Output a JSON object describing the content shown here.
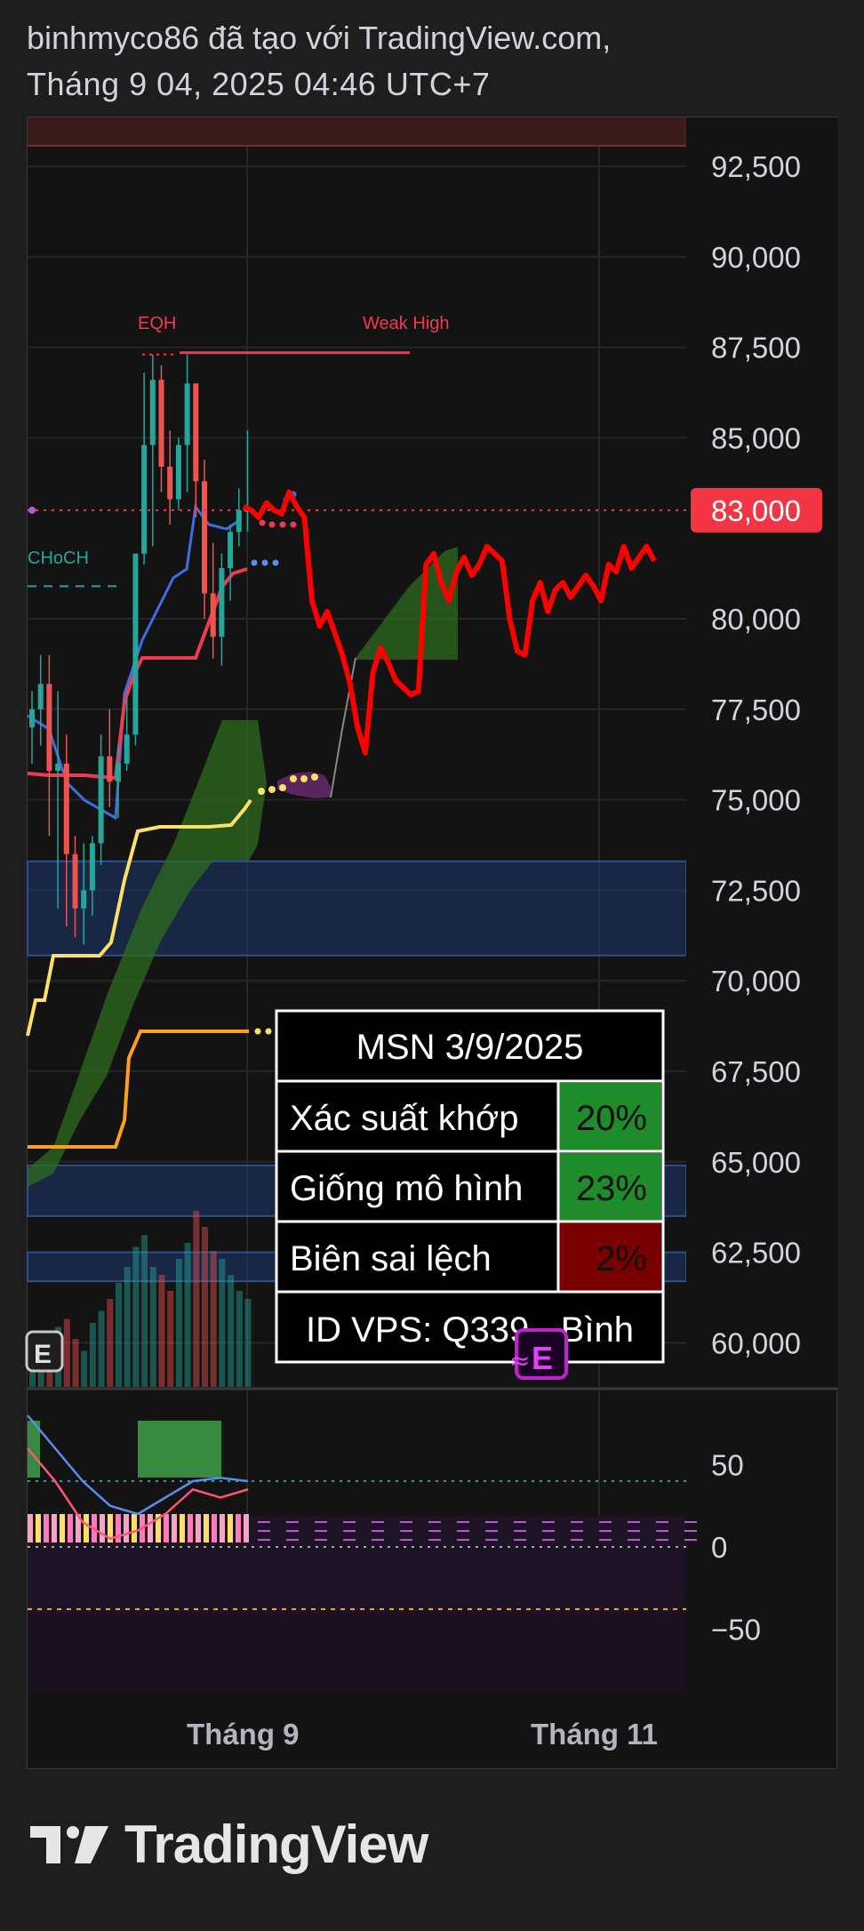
{
  "header": {
    "line1": "binhmyco86 đã tạo với TradingView.com,",
    "line2": "Tháng 9 04, 2025 04:46 UTC+7"
  },
  "brand": {
    "name": "TradingView",
    "icon": "tradingview-logo-icon"
  },
  "colors": {
    "background": "#131313",
    "page": "#1e1e1e",
    "up": "#26a69a",
    "down": "#ef5350",
    "price_label": "#f23645",
    "cloud_green": "#2e7d32",
    "cloud_purple": "#6a2c70",
    "forecast": "#ff0000",
    "yellow_line": "#ffe066",
    "orange_line": "#ff9f1c",
    "zone_blue": "#1e3a6e"
  },
  "chart_data": [
    {
      "type": "candlestick",
      "symbol": "MSN",
      "ylim": [
        59000,
        93500
      ],
      "y_ticks": [
        {
          "value": 92500,
          "label": "92,500"
        },
        {
          "value": 90000,
          "label": "90,000"
        },
        {
          "value": 87500,
          "label": "87,500"
        },
        {
          "value": 85000,
          "label": "85,000"
        },
        {
          "value": 80000,
          "label": "80,000"
        },
        {
          "value": 77500,
          "label": "77,500"
        },
        {
          "value": 75000,
          "label": "75,000"
        },
        {
          "value": 72500,
          "label": "72,500"
        },
        {
          "value": 70000,
          "label": "70,000"
        },
        {
          "value": 67500,
          "label": "67,500"
        },
        {
          "value": 65000,
          "label": "65,000"
        },
        {
          "value": 62500,
          "label": "62,500"
        },
        {
          "value": 60000,
          "label": "60,000"
        }
      ],
      "last_price": {
        "value": 83000,
        "label": "83,000"
      },
      "x_labels": [
        "Tháng 9",
        "Tháng 11"
      ],
      "annotations": {
        "eqh": "EQH",
        "weak_high": "Weak High",
        "choch": "CHoCH",
        "earnings_marker": "E"
      },
      "levels": {
        "eqh_line": 87300,
        "choch_line": 80900
      },
      "zones": [
        {
          "from": 70700,
          "to": 73300
        },
        {
          "from": 63500,
          "to": 64900
        },
        {
          "from": 61700,
          "to": 62500
        }
      ],
      "candles": [
        {
          "o": 77000,
          "h": 78000,
          "l": 76000,
          "c": 77500
        },
        {
          "o": 77500,
          "h": 79000,
          "l": 76500,
          "c": 78200
        },
        {
          "o": 78200,
          "h": 79000,
          "l": 74000,
          "c": 75800
        },
        {
          "o": 75800,
          "h": 78000,
          "l": 72000,
          "c": 76000
        },
        {
          "o": 76000,
          "h": 76800,
          "l": 71500,
          "c": 73500
        },
        {
          "o": 73500,
          "h": 74000,
          "l": 71200,
          "c": 72000
        },
        {
          "o": 72000,
          "h": 73800,
          "l": 71000,
          "c": 72500
        },
        {
          "o": 72500,
          "h": 74000,
          "l": 71800,
          "c": 73800
        },
        {
          "o": 73800,
          "h": 76800,
          "l": 73200,
          "c": 76200
        },
        {
          "o": 76200,
          "h": 77500,
          "l": 74800,
          "c": 75500
        },
        {
          "o": 75500,
          "h": 76500,
          "l": 74500,
          "c": 76000
        },
        {
          "o": 76000,
          "h": 77800,
          "l": 75800,
          "c": 76800
        },
        {
          "o": 76800,
          "h": 81800,
          "l": 76500,
          "c": 81800
        },
        {
          "o": 81800,
          "h": 86800,
          "l": 81500,
          "c": 84800
        },
        {
          "o": 84800,
          "h": 87300,
          "l": 82000,
          "c": 86600
        },
        {
          "o": 86600,
          "h": 87000,
          "l": 83500,
          "c": 84200
        },
        {
          "o": 84200,
          "h": 85200,
          "l": 82600,
          "c": 83300
        },
        {
          "o": 83300,
          "h": 85000,
          "l": 83000,
          "c": 84800
        },
        {
          "o": 84800,
          "h": 87300,
          "l": 83500,
          "c": 86500
        },
        {
          "o": 86500,
          "h": 86500,
          "l": 82800,
          "c": 83800
        },
        {
          "o": 83800,
          "h": 84400,
          "l": 80000,
          "c": 80700
        },
        {
          "o": 80700,
          "h": 82100,
          "l": 78900,
          "c": 79500
        },
        {
          "o": 79500,
          "h": 81800,
          "l": 78700,
          "c": 81400
        },
        {
          "o": 81400,
          "h": 82600,
          "l": 80500,
          "c": 82400
        },
        {
          "o": 82400,
          "h": 83600,
          "l": 82000,
          "c": 83000
        },
        {
          "o": 83000,
          "h": 85200,
          "l": 82400,
          "c": 83000
        }
      ],
      "forecast_path": [
        83100,
        83000,
        82800,
        83200,
        83000,
        82900,
        83500,
        83100,
        82800,
        80500,
        79800,
        80200,
        79600,
        79000,
        78200,
        77000,
        76300,
        78500,
        79200,
        78800,
        78300,
        78100,
        77900,
        78000,
        81500,
        81800,
        81000,
        80500,
        81300,
        81700,
        81200,
        81500,
        82000,
        81800,
        81600,
        80000,
        79100,
        79000,
        80500,
        81000,
        80200,
        80800,
        81000,
        80600,
        80900,
        81200,
        80900,
        80500,
        81500,
        81300,
        82000,
        81400,
        81700,
        82000,
        81600
      ],
      "indicator_table": {
        "title": "MSN 3/9/2025",
        "rows": [
          {
            "label": "Xác suất khớp",
            "value": "20%",
            "color": "#1e8c2a"
          },
          {
            "label": "Giống mô hình",
            "value": "23%",
            "color": "#1e8c2a"
          },
          {
            "label": "Biên sai lệch",
            "value": "2%",
            "color": "#7a0000"
          }
        ],
        "footer": "ID VPS: Q339 - Bình"
      }
    },
    {
      "type": "line",
      "name": "oscillator",
      "ylim": [
        -70,
        95
      ],
      "y_ticks": [
        {
          "value": 50,
          "label": "50"
        },
        {
          "value": 0,
          "label": "0"
        },
        {
          "value": -50,
          "label": "−50"
        }
      ],
      "upper_level": 40,
      "lower_level": -40,
      "series": [
        {
          "color": "#5b8def",
          "values": [
            80,
            60,
            40,
            25,
            20,
            30,
            40,
            42,
            40
          ]
        },
        {
          "color": "#ff5577",
          "values": [
            60,
            40,
            15,
            5,
            10,
            20,
            35,
            30,
            35
          ]
        }
      ]
    }
  ]
}
